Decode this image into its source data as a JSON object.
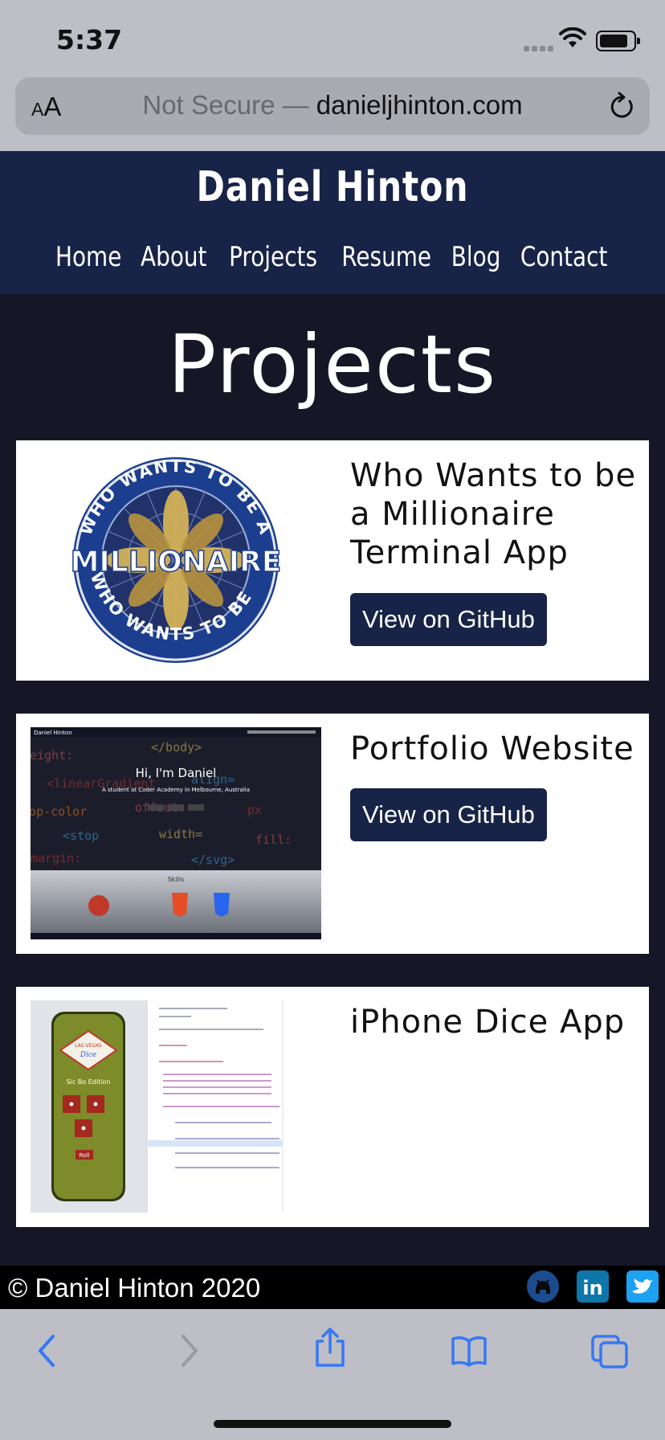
{
  "status": {
    "time": "5:37"
  },
  "browser": {
    "text_size_label": "AA",
    "url_prefix": "Not Secure —",
    "url_domain": "danieljhinton.com"
  },
  "site": {
    "title": "Daniel Hinton",
    "nav": [
      "Home",
      "About",
      "Projects",
      "Resume",
      "Blog",
      "Contact"
    ]
  },
  "page": {
    "title": "Projects"
  },
  "projects": [
    {
      "title_lines": [
        "Who Wants to be",
        "a Millionaire",
        "Terminal App"
      ],
      "button": "View on GitHub"
    },
    {
      "title_lines": [
        "Portfolio Website"
      ],
      "button": "View on GitHub"
    },
    {
      "title_lines": [
        "iPhone Dice App"
      ]
    }
  ],
  "thumbs": {
    "millionaire": {
      "top_text": "WHO WANTS TO BE A",
      "center_text": "MILLIONAIRE",
      "bottom_text": "WHO WANTS TO BE A"
    },
    "portfolio": {
      "nav_title": "Daniel Hinton",
      "heading": "Hi, I'm Daniel",
      "sub": "A student at Coder Academy in Melbourne, Australia",
      "skills": "Skills"
    },
    "dice": {
      "logo_top": "LAS VEGAS",
      "logo_mid": "Dice",
      "edition": "Sic Bo Edition",
      "roll": "Roll"
    }
  },
  "footer": {
    "copyright": "© Daniel Hinton 2020",
    "icons": [
      "github-icon",
      "linkedin-icon",
      "twitter-icon"
    ]
  },
  "colors": {
    "navy": "#172347",
    "dark_bg": "#161627",
    "ios_blue": "#3478f6"
  }
}
